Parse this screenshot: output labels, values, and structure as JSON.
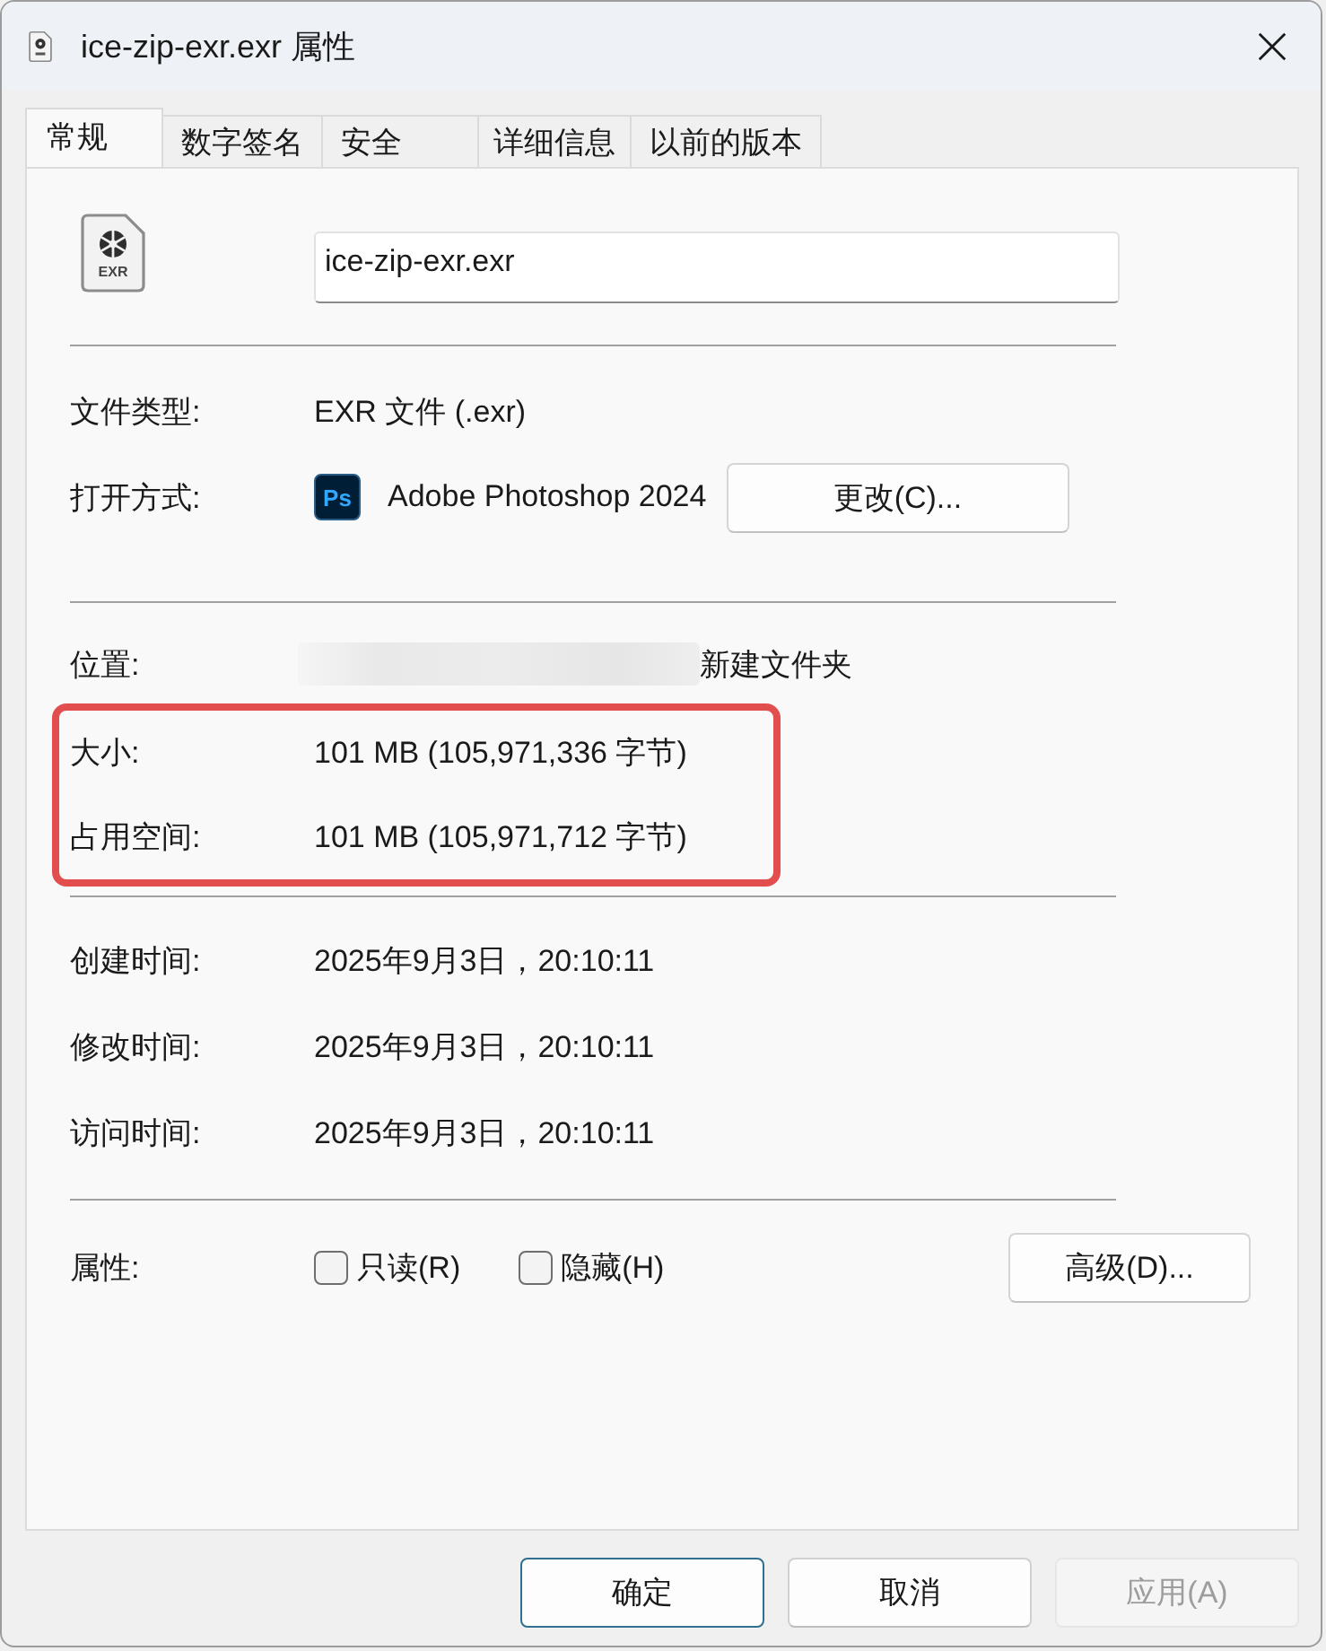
{
  "window": {
    "title": "ice-zip-exr.exr 属性"
  },
  "tabs": [
    {
      "label": "常规",
      "selected": true
    },
    {
      "label": "数字签名",
      "selected": false
    },
    {
      "label": "安全",
      "selected": false
    },
    {
      "label": "详细信息",
      "selected": false
    },
    {
      "label": "以前的版本",
      "selected": false
    }
  ],
  "file": {
    "icon_label": "EXR",
    "name": "ice-zip-exr.exr"
  },
  "type_rows": [
    {
      "kind": "text",
      "label": "文件类型:",
      "value": "EXR 文件 (.exr)"
    },
    {
      "kind": "app",
      "label": "打开方式:",
      "icon_label": "Ps",
      "value": "Adobe Photoshop 2024",
      "button": "更改(C)..."
    }
  ],
  "location": {
    "label": "位置:",
    "redacted": true,
    "value": "新建文件夹"
  },
  "size": {
    "highlighted": true,
    "rows": [
      {
        "label": "大小:",
        "value": "101 MB (105,971,336 字节)"
      },
      {
        "label": "占用空间:",
        "value": "101 MB (105,971,712 字节)"
      }
    ]
  },
  "time_rows": [
    {
      "label": "创建时间:",
      "value": "2025年9月3日，20:10:11"
    },
    {
      "label": "修改时间:",
      "value": "2025年9月3日，20:10:11"
    },
    {
      "label": "访问时间:",
      "value": "2025年9月3日，20:10:11"
    }
  ],
  "attributes": {
    "label": "属性:",
    "options": [
      {
        "label": "只读(R)",
        "checked": false
      },
      {
        "label": "隐藏(H)",
        "checked": false
      }
    ],
    "button": "高级(D)..."
  },
  "buttons": [
    {
      "label": "确定",
      "kind": "default",
      "disabled": false
    },
    {
      "label": "取消",
      "kind": "normal",
      "disabled": false
    },
    {
      "label": "应用(A)",
      "kind": "normal",
      "disabled": true
    }
  ]
}
